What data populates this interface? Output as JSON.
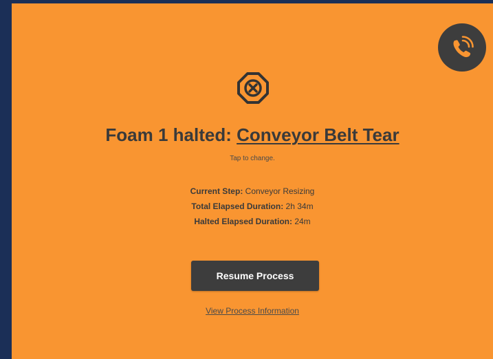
{
  "colors": {
    "background": "#1b2f57",
    "panel": "#f99531",
    "dark": "#3d3d3d",
    "text": "#3a3a3a"
  },
  "header": {
    "call_icon": "phone-ringing-icon"
  },
  "status": {
    "icon": "octagon-x-icon",
    "title_prefix": "Foam 1 halted: ",
    "halt_reason": "Conveyor Belt Tear",
    "hint": "Tap to change."
  },
  "details": {
    "current_step_label": "Current Step:",
    "current_step_value": " Conveyor Resizing",
    "total_elapsed_label": "Total Elapsed Duration:",
    "total_elapsed_value": " 2h 34m",
    "halted_elapsed_label": "Halted Elapsed Duration:",
    "halted_elapsed_value": " 24m"
  },
  "actions": {
    "resume_label": "Resume Process",
    "info_link": "View Process Information"
  }
}
